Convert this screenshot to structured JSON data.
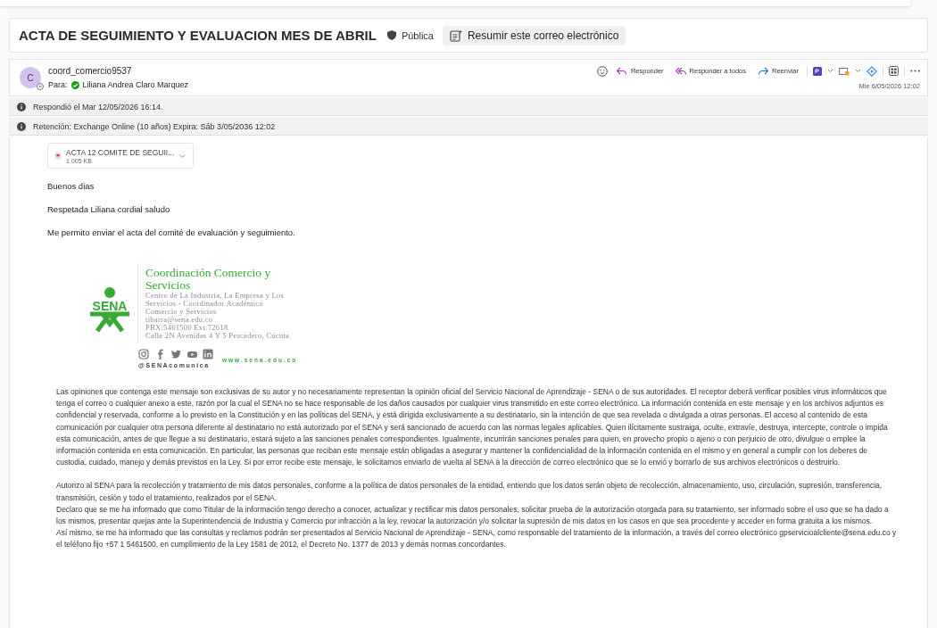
{
  "subject": {
    "title": "ACTA DE SEGUIMIENTO Y EVALUACION MES DE ABRIL",
    "sensitivity": "Pública",
    "summarize_button": "Resumir este correo electrónico"
  },
  "message": {
    "avatar_initial": "C",
    "sender": "coord_comercio9537",
    "to_label": "Para:",
    "recipient": "Liliana Andrea Claro Marquez",
    "date": "Mie 6/05/2026 12:02",
    "actions": [
      {
        "kind": "reply",
        "label": "Responder"
      },
      {
        "kind": "reply-all",
        "label": "Responder a todos"
      },
      {
        "kind": "forward",
        "label": "Reenviar"
      }
    ]
  },
  "info_bars": [
    "Respondió el Mar 12/05/2026 16:14.",
    "Retención: Exchange Online (10 años) Expira: Sáb 3/05/2036 12:02"
  ],
  "attachment": {
    "name": "ACTA 12 COMITE DE SEGUII...",
    "size": "1.005 KB"
  },
  "body": [
    "Buenos dias",
    "Respetada Liliana cordial saludo",
    "Me permito enviar el acta del comité de evaluación y seguimiento."
  ],
  "signature": {
    "logo_text": "SENA",
    "title": "Coordinación Comercio y Servicios",
    "lines": [
      "Centro de La Industria, La Empresa y Los Servicios - Coordinador Académico",
      "Comercio y Servicios",
      "tibarra@sena.edu.co",
      "PBX:5461500 Ext:72618",
      "Calle 2N Avenidas 4 Y 5 Pescadero, Cúcuta"
    ],
    "website": "www.sena.edu.co",
    "handle": "@SENAcomunica"
  },
  "disclaimer": [
    "Las opiniones que contenga este mensaje son exclusivas de su autor y no necesariamente representan la opinión oficial del Servicio Nacional de Aprendizaje - SENA o de sus autoridades. El receptor deberá verificar posibles virus informáticos que tenga el correo o cualquier anexo a este, razón por la cual el SENA no se hace responsable de los daños causados por cualquier virus transmitido en este correo electrónico. La información contenida en este mensaje y en los archivos adjuntos es confidencial y reservada, conforme a lo previsto en la Constitución y en las políticas del SENA, y está dirigida exclusivamente a su destinatario, sin la intención de que sea revelada o divulgada a otras personas. El acceso al contenido de esta comunicación por cualquier otra persona diferente al destinatario no está autorizado por el SENA y será sancionado de acuerdo con las normas legales aplicables. Quien ilícitamente sustraiga, oculte, extravíe, destruya, intercepte, controle o impida esta comunicación, antes de que llegue a su destinatario, estará sujeto a las sanciones penales correspondientes. Igualmente, incurrirán sanciones penales para quien, en provecho propio o ajeno o con perjuicio de otro, divulgue o emplee la información contenida en esta comunicación. En particular, las personas que reciban este mensaje están obligadas a asegurar y mantener la confidencialidad de la información contenida en el mismo y en general a cumplir con los deberes de custodia, cuidado, manejo y demás previstos en la Ley. Si por error recibe este mensaje, le solicitamos enviarlo de vuelta al SENA a la dirección de correo electrónico que se lo envió y borrarlo de sus archivos electrónicos o destruirlo."
  ],
  "privacy": [
    "Autorizo al SENA para la recolección y tratamiento de mis datos personales, conforme a la política de datos personales de la entidad, entiendo que los datos serán objeto de recolección, almacenamiento, uso, circulación, supresión, transferencia, transmisión, cesión y todo el tratamiento, realizados por el SENA.",
    "Declaro que se me ha informado que como Titular de la información tengo derecho a conocer, actualizar y rectificar mis datos personales, solicitar prueba de la autorización otorgada para su tratamiento, ser informado sobre el uso que se ha dado a los mismos, presentar quejas ante la Superintendencia de Industria y Comercio por infracción a la ley, revocar la autorización y/o solicitar la supresión de mis datos en los casos en que sea procedente y acceder en forma gratuita a los mismos.",
    "Así mismo, se me ha informado que las consultas y reclamos podrán ser presentados al Servicio Nacional de Aprendizaje - SENA, como responsable del tratamiento de la información, a través del correo electrónico gpservicioalcliente@sena.edu.co y el teléfono fijo +57 1 5461500, en cumplimiento de la Ley 1581 de 2012, el Decreto No. 1377 de 2013 y demás normas concordantes."
  ]
}
